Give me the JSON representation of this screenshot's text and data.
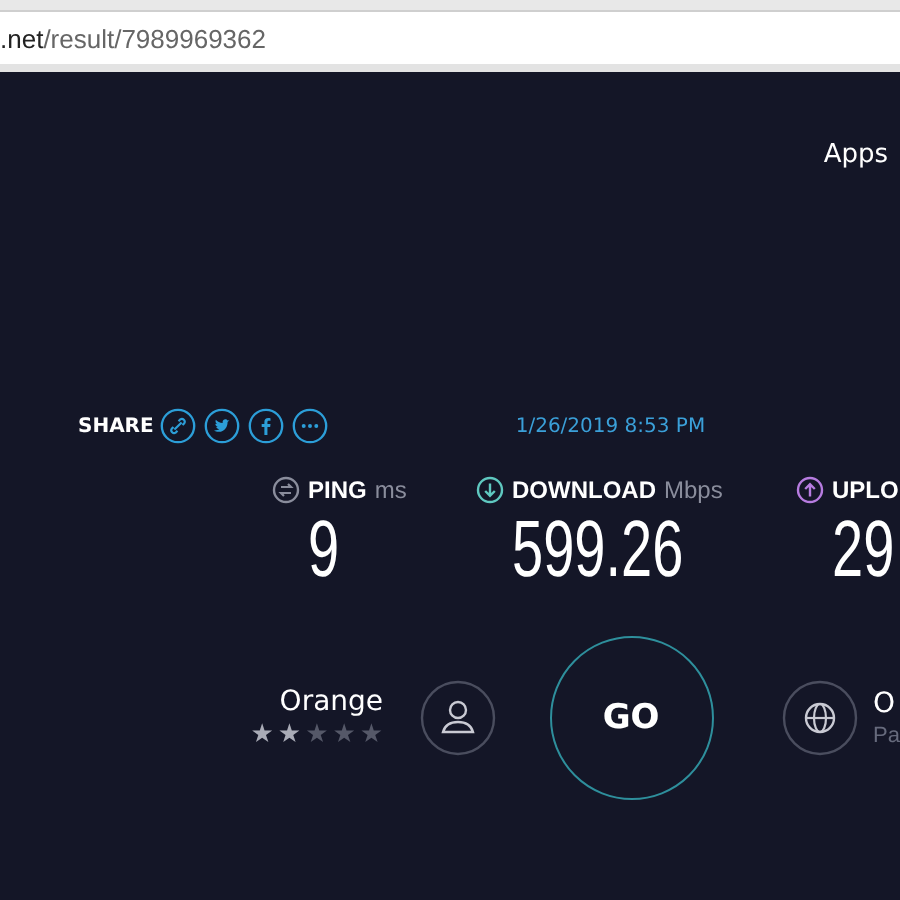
{
  "address_bar": {
    "domain": ".net",
    "path": "/result/7989969362"
  },
  "nav": {
    "apps": "Apps"
  },
  "share": {
    "label": "SHARE"
  },
  "date": "1/26/2019 8:53 PM",
  "metrics": [
    {
      "kind": "ping",
      "label": "PING",
      "unit": "ms",
      "value": "9"
    },
    {
      "kind": "download",
      "label": "DOWNLOAD",
      "unit": "Mbps",
      "value": "599.26"
    },
    {
      "kind": "upload",
      "label": "UPLO",
      "value": "29"
    }
  ],
  "isp": {
    "name": "Orange",
    "stars": 2
  },
  "go": "GO",
  "server": {
    "name": "O",
    "location": "Pa"
  }
}
